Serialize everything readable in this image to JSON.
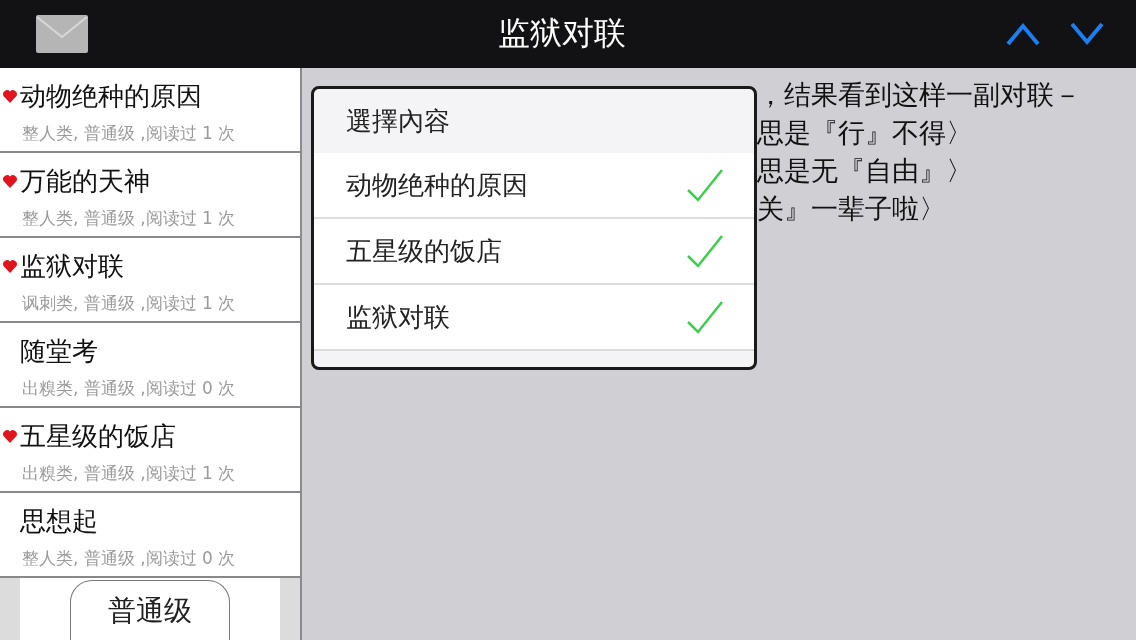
{
  "header": {
    "title": "监狱对联"
  },
  "list": [
    {
      "title": "动物绝种的原因",
      "meta": "整人类, 普通级 ,阅读过 1 次",
      "favorite": true
    },
    {
      "title": "万能的天神",
      "meta": "整人类, 普通级 ,阅读过 1 次",
      "favorite": true
    },
    {
      "title": "监狱对联",
      "meta": "讽刺类, 普通级 ,阅读过 1 次",
      "favorite": true
    },
    {
      "title": "随堂考",
      "meta": "出糗类, 普通级 ,阅读过 0 次",
      "favorite": false
    },
    {
      "title": "五星级的饭店",
      "meta": "出糗类, 普通级 ,阅读过 1 次",
      "favorite": true
    },
    {
      "title": "思想起",
      "meta": "整人类, 普通级 ,阅读过 0 次",
      "favorite": false
    }
  ],
  "toolbar": {
    "button": "普通级"
  },
  "article": {
    "lines": [
      "，结果看到这样一副对联－",
      "思是『行』不得〉",
      "思是无『自由』〉",
      "关』一辈子啦〉"
    ]
  },
  "popup": {
    "title": "選擇內容",
    "items": [
      {
        "label": "动物绝种的原因",
        "checked": true
      },
      {
        "label": "五星级的饭店",
        "checked": true
      },
      {
        "label": "监狱对联",
        "checked": true
      }
    ]
  }
}
